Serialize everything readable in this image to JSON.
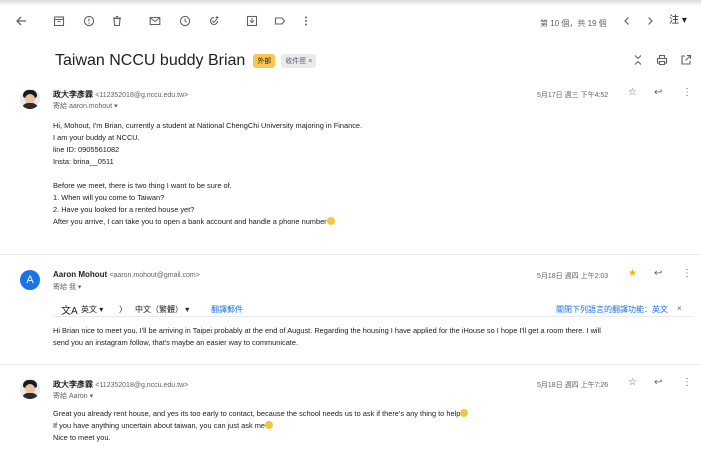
{
  "toolbar": {
    "pager_text": "第 10 個，共 19 個",
    "lang_label": "注 ▾"
  },
  "thread": {
    "subject": "Taiwan NCCU buddy Brian",
    "label_external": "外部",
    "label_inbox": "收件匣 ×"
  },
  "messages": [
    {
      "sender_name": "政大李彥霖",
      "sender_email": "<112352018@g.nccu.edu.tw>",
      "to_line": "寄給 aaron.mohout ▾",
      "date": "5月17日 週三 下午4:52",
      "starred": false,
      "body": [
        "Hi, Mohout, I'm Brian, currently a student at National ChengChi University majoring in Finance.",
        "I am your buddy at NCCU.",
        "line ID: 0905561082",
        "Insta: brina__0511",
        "",
        "Before we meet, there is two thing I want to be sure of.",
        "1. When will you come to Taiwan?",
        "2. Have you looked for a rented house yet?",
        "After you arrive, I can take you to open a bank account and handle a phone number"
      ]
    },
    {
      "avatar_letter": "A",
      "sender_name": "Aaron Mohout",
      "sender_email": "<aaron.mohout@gmail.com>",
      "to_line": "寄給 我 ▾",
      "date": "5月18日 週四 上午2:03",
      "starred": true,
      "translate": {
        "source_lang": "英文 ▾",
        "arrow": "〉",
        "target_lang": "中文（繁體） ▾",
        "translate_link": "翻譯郵件",
        "off_link": "關閉下列語言的翻譯功能：英文",
        "close": "×"
      },
      "body": [
        "Hi Brian nice to meet you. I'll be arriving in Taipei probably at the end of August. Regarding the housing I have applied for the iHouse so I hope I'll get a room there. I will",
        "send you an instagram follow, that's maybe an easier way to communicate."
      ]
    },
    {
      "sender_name": "政大李彥霖",
      "sender_email": "<112352018@g.nccu.edu.tw>",
      "to_line": "寄給 Aaron ▾",
      "date": "5月18日 週四 上午7:26",
      "starred": false,
      "body": [
        "Great you already rent house, and yes its too early to contact, because the school needs us to ask if there's any thing to help",
        "If you have anything uncertain about taiwan, you can just ask me",
        "Nice to meet you."
      ]
    }
  ],
  "icons": {
    "star_empty": "☆",
    "star_full": "★",
    "reply": "↩",
    "more": "⋮"
  },
  "colors": {
    "accent": "#1a73e8",
    "external_badge": "#f9c74f",
    "star": "#f4b400"
  }
}
